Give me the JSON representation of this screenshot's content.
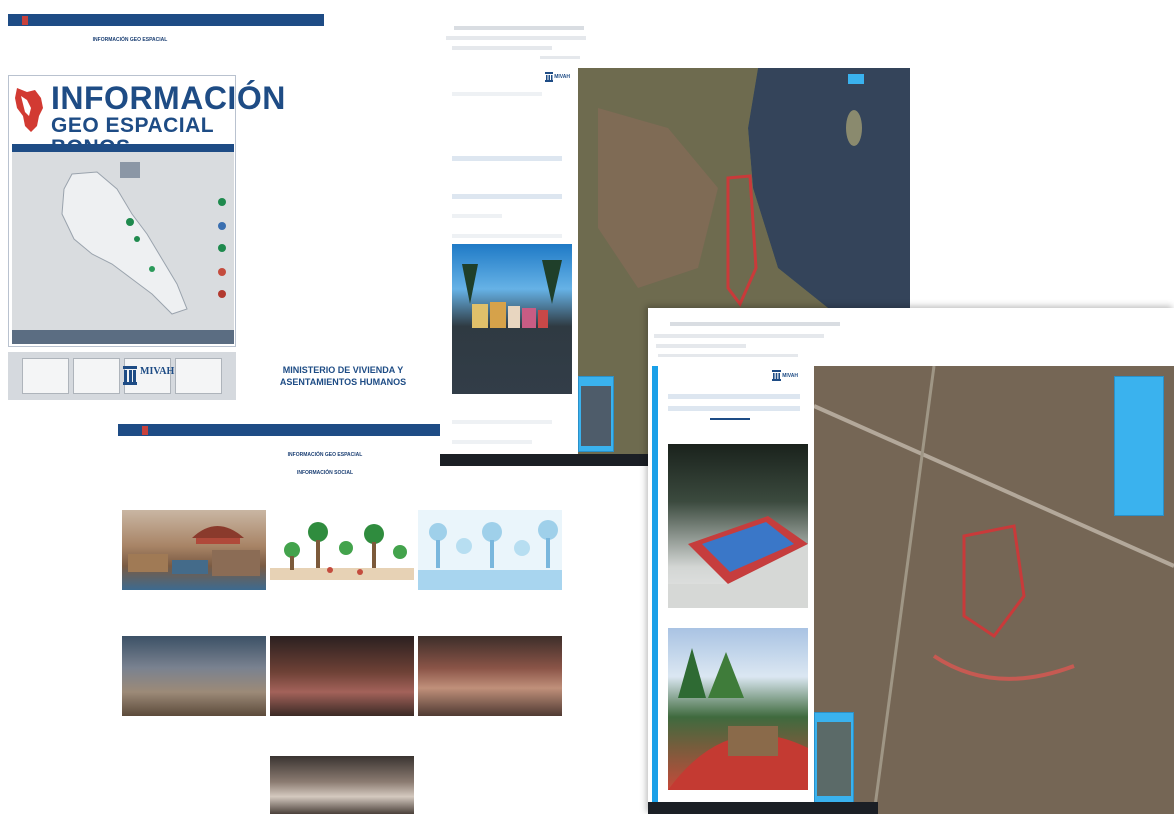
{
  "screen1": {
    "nav_items": [
      "",
      "",
      "",
      "",
      "",
      "",
      "",
      ""
    ],
    "heading": "INFORMACIÓN GEO ESPACIAL",
    "banner": {
      "title_line1": "INFORMACIÓN",
      "title_line2": "GEO ESPACIAL BONOS"
    }
  },
  "screen2": {
    "logo_text": "MIVAH",
    "ministry_line1": "MINISTERIO DE VIVIENDA Y",
    "ministry_line2": "ASENTAMIENTOS HUMANOS",
    "heading": "INFORMACIÓN GEO ESPACIAL",
    "subheading": "INFORMACIÓN SOCIAL"
  },
  "screen3": {
    "logo_text": "MIVAH"
  },
  "screen4": {
    "logo_text": "MIVAH"
  },
  "colors": {
    "nav_blue": "#1e4c85",
    "nav_active": "#c8413b",
    "panel_blue": "#3ab2ee",
    "left_stripe": "#1aa0e8"
  }
}
